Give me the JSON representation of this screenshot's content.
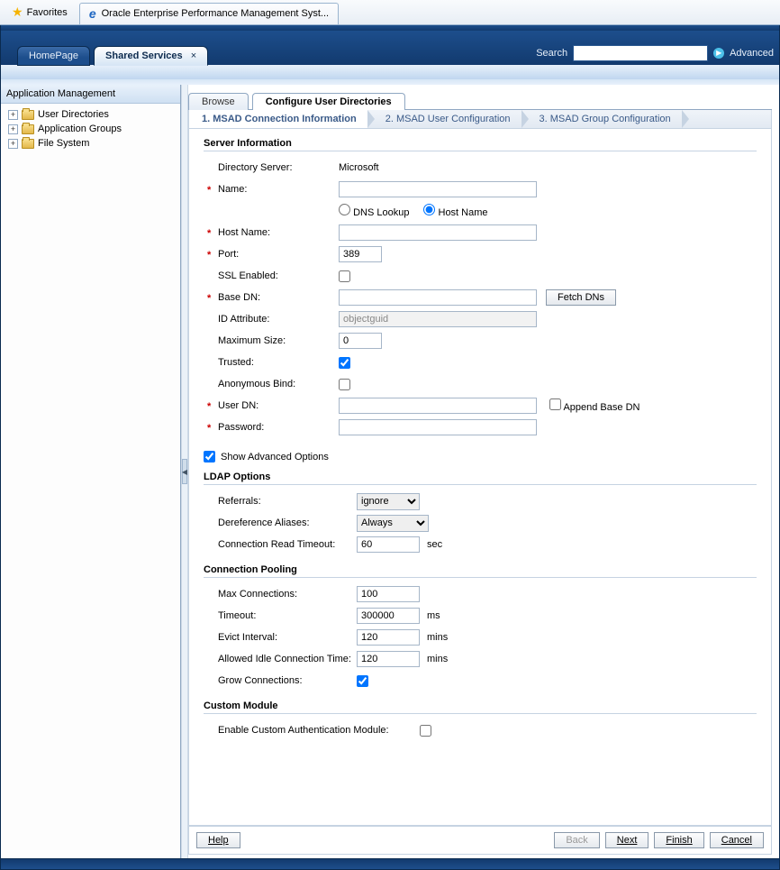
{
  "browser": {
    "favorites_label": "Favorites",
    "tab_title": "Oracle Enterprise Performance Management Syst..."
  },
  "workspace": {
    "tabs": [
      {
        "label": "HomePage",
        "active": false
      },
      {
        "label": "Shared Services",
        "active": true
      }
    ],
    "search_label": "Search",
    "search_value": "",
    "advanced_label": "Advanced"
  },
  "sidebar": {
    "title": "Application Management",
    "items": [
      {
        "label": "User Directories"
      },
      {
        "label": "Application Groups"
      },
      {
        "label": "File System"
      }
    ]
  },
  "content_tabs": {
    "browse": "Browse",
    "configure": "Configure User Directories"
  },
  "wizard": {
    "step1": "1. MSAD Connection Information",
    "step2": "2. MSAD User Configuration",
    "step3": "3. MSAD Group Configuration"
  },
  "server_info": {
    "section": "Server Information",
    "directory_server_label": "Directory Server:",
    "directory_server_value": "Microsoft",
    "name_label": "Name:",
    "name_value": "",
    "dns_lookup": "DNS Lookup",
    "host_name_radio": "Host Name",
    "host_name_label": "Host Name:",
    "host_name_value": "",
    "port_label": "Port:",
    "port_value": "389",
    "ssl_label": "SSL Enabled:",
    "base_dn_label": "Base DN:",
    "base_dn_value": "",
    "fetch_dns": "Fetch DNs",
    "id_attr_label": "ID Attribute:",
    "id_attr_value": "objectguid",
    "max_size_label": "Maximum Size:",
    "max_size_value": "0",
    "trusted_label": "Trusted:",
    "anon_bind_label": "Anonymous Bind:",
    "user_dn_label": "User DN:",
    "user_dn_value": "",
    "append_base_dn": "Append Base DN",
    "password_label": "Password:",
    "password_value": ""
  },
  "show_advanced": "Show Advanced Options",
  "ldap": {
    "section": "LDAP Options",
    "referrals_label": "Referrals:",
    "referrals_value": "ignore",
    "deref_label": "Dereference Aliases:",
    "deref_value": "Always",
    "timeout_label": "Connection Read Timeout:",
    "timeout_value": "60",
    "timeout_unit": "sec"
  },
  "pool": {
    "section": "Connection Pooling",
    "max_conn_label": "Max Connections:",
    "max_conn_value": "100",
    "timeout_label": "Timeout:",
    "timeout_value": "300000",
    "timeout_unit": "ms",
    "evict_label": "Evict Interval:",
    "evict_value": "120",
    "evict_unit": "mins",
    "idle_label": "Allowed Idle Connection Time:",
    "idle_value": "120",
    "idle_unit": "mins",
    "grow_label": "Grow Connections:"
  },
  "custom": {
    "section": "Custom Module",
    "enable_label": "Enable Custom Authentication Module:"
  },
  "foot": {
    "help": "Help",
    "back": "Back",
    "next": "Next",
    "finish": "Finish",
    "cancel": "Cancel"
  }
}
